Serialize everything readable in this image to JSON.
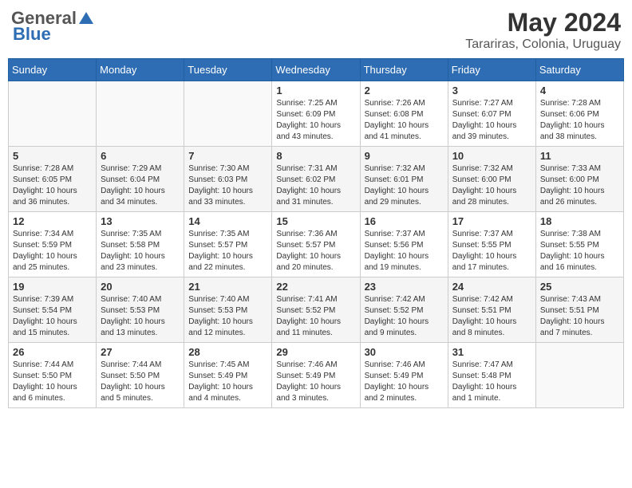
{
  "header": {
    "logo_general": "General",
    "logo_blue": "Blue",
    "month_year": "May 2024",
    "location": "Tarariras, Colonia, Uruguay"
  },
  "days_of_week": [
    "Sunday",
    "Monday",
    "Tuesday",
    "Wednesday",
    "Thursday",
    "Friday",
    "Saturday"
  ],
  "weeks": [
    [
      {
        "day": "",
        "info": ""
      },
      {
        "day": "",
        "info": ""
      },
      {
        "day": "",
        "info": ""
      },
      {
        "day": "1",
        "info": "Sunrise: 7:25 AM\nSunset: 6:09 PM\nDaylight: 10 hours\nand 43 minutes."
      },
      {
        "day": "2",
        "info": "Sunrise: 7:26 AM\nSunset: 6:08 PM\nDaylight: 10 hours\nand 41 minutes."
      },
      {
        "day": "3",
        "info": "Sunrise: 7:27 AM\nSunset: 6:07 PM\nDaylight: 10 hours\nand 39 minutes."
      },
      {
        "day": "4",
        "info": "Sunrise: 7:28 AM\nSunset: 6:06 PM\nDaylight: 10 hours\nand 38 minutes."
      }
    ],
    [
      {
        "day": "5",
        "info": "Sunrise: 7:28 AM\nSunset: 6:05 PM\nDaylight: 10 hours\nand 36 minutes."
      },
      {
        "day": "6",
        "info": "Sunrise: 7:29 AM\nSunset: 6:04 PM\nDaylight: 10 hours\nand 34 minutes."
      },
      {
        "day": "7",
        "info": "Sunrise: 7:30 AM\nSunset: 6:03 PM\nDaylight: 10 hours\nand 33 minutes."
      },
      {
        "day": "8",
        "info": "Sunrise: 7:31 AM\nSunset: 6:02 PM\nDaylight: 10 hours\nand 31 minutes."
      },
      {
        "day": "9",
        "info": "Sunrise: 7:32 AM\nSunset: 6:01 PM\nDaylight: 10 hours\nand 29 minutes."
      },
      {
        "day": "10",
        "info": "Sunrise: 7:32 AM\nSunset: 6:00 PM\nDaylight: 10 hours\nand 28 minutes."
      },
      {
        "day": "11",
        "info": "Sunrise: 7:33 AM\nSunset: 6:00 PM\nDaylight: 10 hours\nand 26 minutes."
      }
    ],
    [
      {
        "day": "12",
        "info": "Sunrise: 7:34 AM\nSunset: 5:59 PM\nDaylight: 10 hours\nand 25 minutes."
      },
      {
        "day": "13",
        "info": "Sunrise: 7:35 AM\nSunset: 5:58 PM\nDaylight: 10 hours\nand 23 minutes."
      },
      {
        "day": "14",
        "info": "Sunrise: 7:35 AM\nSunset: 5:57 PM\nDaylight: 10 hours\nand 22 minutes."
      },
      {
        "day": "15",
        "info": "Sunrise: 7:36 AM\nSunset: 5:57 PM\nDaylight: 10 hours\nand 20 minutes."
      },
      {
        "day": "16",
        "info": "Sunrise: 7:37 AM\nSunset: 5:56 PM\nDaylight: 10 hours\nand 19 minutes."
      },
      {
        "day": "17",
        "info": "Sunrise: 7:37 AM\nSunset: 5:55 PM\nDaylight: 10 hours\nand 17 minutes."
      },
      {
        "day": "18",
        "info": "Sunrise: 7:38 AM\nSunset: 5:55 PM\nDaylight: 10 hours\nand 16 minutes."
      }
    ],
    [
      {
        "day": "19",
        "info": "Sunrise: 7:39 AM\nSunset: 5:54 PM\nDaylight: 10 hours\nand 15 minutes."
      },
      {
        "day": "20",
        "info": "Sunrise: 7:40 AM\nSunset: 5:53 PM\nDaylight: 10 hours\nand 13 minutes."
      },
      {
        "day": "21",
        "info": "Sunrise: 7:40 AM\nSunset: 5:53 PM\nDaylight: 10 hours\nand 12 minutes."
      },
      {
        "day": "22",
        "info": "Sunrise: 7:41 AM\nSunset: 5:52 PM\nDaylight: 10 hours\nand 11 minutes."
      },
      {
        "day": "23",
        "info": "Sunrise: 7:42 AM\nSunset: 5:52 PM\nDaylight: 10 hours\nand 9 minutes."
      },
      {
        "day": "24",
        "info": "Sunrise: 7:42 AM\nSunset: 5:51 PM\nDaylight: 10 hours\nand 8 minutes."
      },
      {
        "day": "25",
        "info": "Sunrise: 7:43 AM\nSunset: 5:51 PM\nDaylight: 10 hours\nand 7 minutes."
      }
    ],
    [
      {
        "day": "26",
        "info": "Sunrise: 7:44 AM\nSunset: 5:50 PM\nDaylight: 10 hours\nand 6 minutes."
      },
      {
        "day": "27",
        "info": "Sunrise: 7:44 AM\nSunset: 5:50 PM\nDaylight: 10 hours\nand 5 minutes."
      },
      {
        "day": "28",
        "info": "Sunrise: 7:45 AM\nSunset: 5:49 PM\nDaylight: 10 hours\nand 4 minutes."
      },
      {
        "day": "29",
        "info": "Sunrise: 7:46 AM\nSunset: 5:49 PM\nDaylight: 10 hours\nand 3 minutes."
      },
      {
        "day": "30",
        "info": "Sunrise: 7:46 AM\nSunset: 5:49 PM\nDaylight: 10 hours\nand 2 minutes."
      },
      {
        "day": "31",
        "info": "Sunrise: 7:47 AM\nSunset: 5:48 PM\nDaylight: 10 hours\nand 1 minute."
      },
      {
        "day": "",
        "info": ""
      }
    ]
  ]
}
